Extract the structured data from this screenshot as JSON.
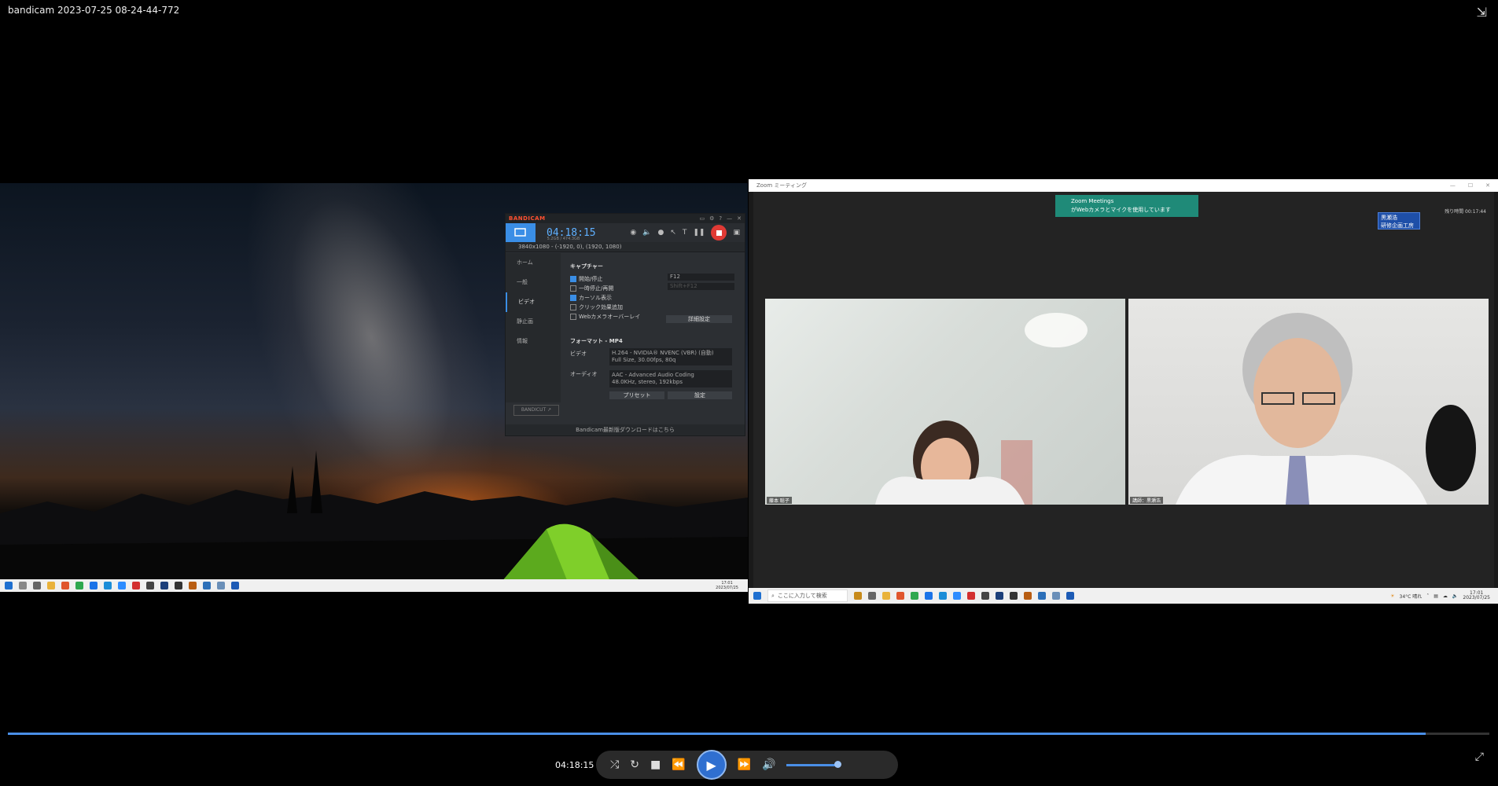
{
  "window": {
    "title": "bandicam 2023-07-25 08-24-44-772",
    "exit_icon": "collapse-icon"
  },
  "bandicam": {
    "logo_a": "BANDI",
    "logo_b": "CAM",
    "timer": "04:18:15",
    "size_text": "5.2GB / 474.3GB",
    "region": "3840x1080 - (-1920, 0), (1920, 1080)",
    "nav": [
      "ホーム",
      "一般",
      "ビデオ",
      "静止画",
      "情報"
    ],
    "capture_header": "キャプチャー",
    "options": [
      {
        "label": "開始/停止",
        "checked": true
      },
      {
        "label": "一時停止/再開",
        "checked": false
      },
      {
        "label": "カーソル表示",
        "checked": true
      },
      {
        "label": "クリック効果追加",
        "checked": false
      },
      {
        "label": "Webカメラオーバーレイ",
        "checked": false
      }
    ],
    "hotkey1": "F12",
    "hotkey2": "Shift+F12",
    "detail_button": "詳細設定",
    "format_header": "フォーマット - MP4",
    "video_label": "ビデオ",
    "video_line1": "H.264 - NVIDIA® NVENC (VBR) (自動)",
    "video_line2": "Full Size, 30.00fps, 80q",
    "audio_label": "オーディオ",
    "audio_line1": "AAC - Advanced Audio Coding",
    "audio_line2": "48.0KHz, stereo, 192kbps",
    "preset_button": "プリセット",
    "settings_button": "設定",
    "bandicut": "BANDICUT ↗",
    "footer": "Bandicam最新版ダウンロードはこちら"
  },
  "zoom": {
    "window_title": "Zoom ミーティング",
    "notice_line1": "Zoom Meetings",
    "notice_line2": "がWebカメラとマイクを使用しています",
    "timer": "残り時間 00:17:44",
    "badge_line1": "黒瀬浩",
    "badge_line2": "研修企画工房",
    "participant1": "藤本 聡子",
    "participant2": "講師：黒瀬浩",
    "search_placeholder": "ここに入力して検索",
    "weather": "34°C 晴れ",
    "clock_time": "17:01",
    "clock_date": "2023/07/25"
  },
  "left_taskbar": {
    "clock_time": "17:01",
    "clock_date": "2023/07/25"
  },
  "player": {
    "time": "04:18:15",
    "progress": 0.957,
    "volume": 0.85,
    "icons": [
      "shuffle-icon",
      "repeat-icon",
      "stop-icon",
      "previous-icon",
      "play-icon",
      "next-icon",
      "volume-icon"
    ]
  }
}
